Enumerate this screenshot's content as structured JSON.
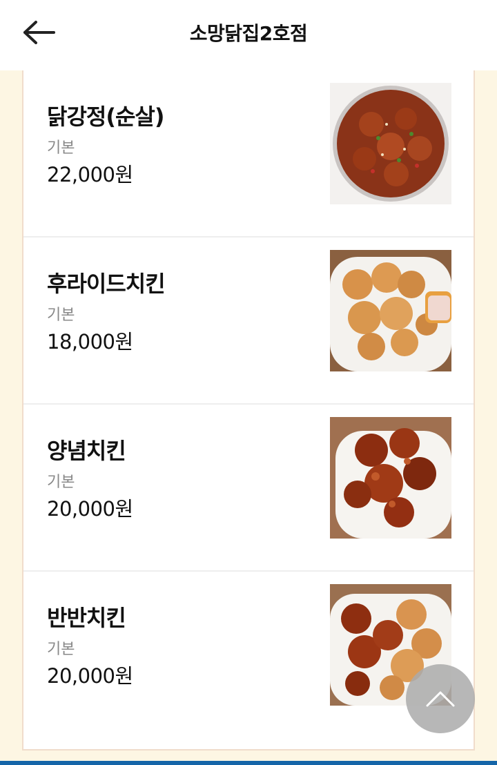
{
  "header": {
    "title": "소망닭집2호점",
    "back_icon": "arrow-left-icon"
  },
  "menu": [
    {
      "name": "닭강정(순살)",
      "option": "기본",
      "price": "22,000원",
      "image": "dakgangjeong-photo"
    },
    {
      "name": "후라이드치킨",
      "option": "기본",
      "price": "18,000원",
      "image": "fried-chicken-photo"
    },
    {
      "name": "양념치킨",
      "option": "기본",
      "price": "20,000원",
      "image": "seasoned-chicken-photo"
    },
    {
      "name": "반반치킨",
      "option": "기본",
      "price": "20,000원",
      "image": "half-half-chicken-photo"
    }
  ],
  "scroll_top": {
    "icon": "chevron-up-icon"
  },
  "colors": {
    "background": "#fdf6e3",
    "panel_border": "#f0dccb",
    "bottom_bar": "#1565a8",
    "scroll_button": "#aaaaaa"
  }
}
